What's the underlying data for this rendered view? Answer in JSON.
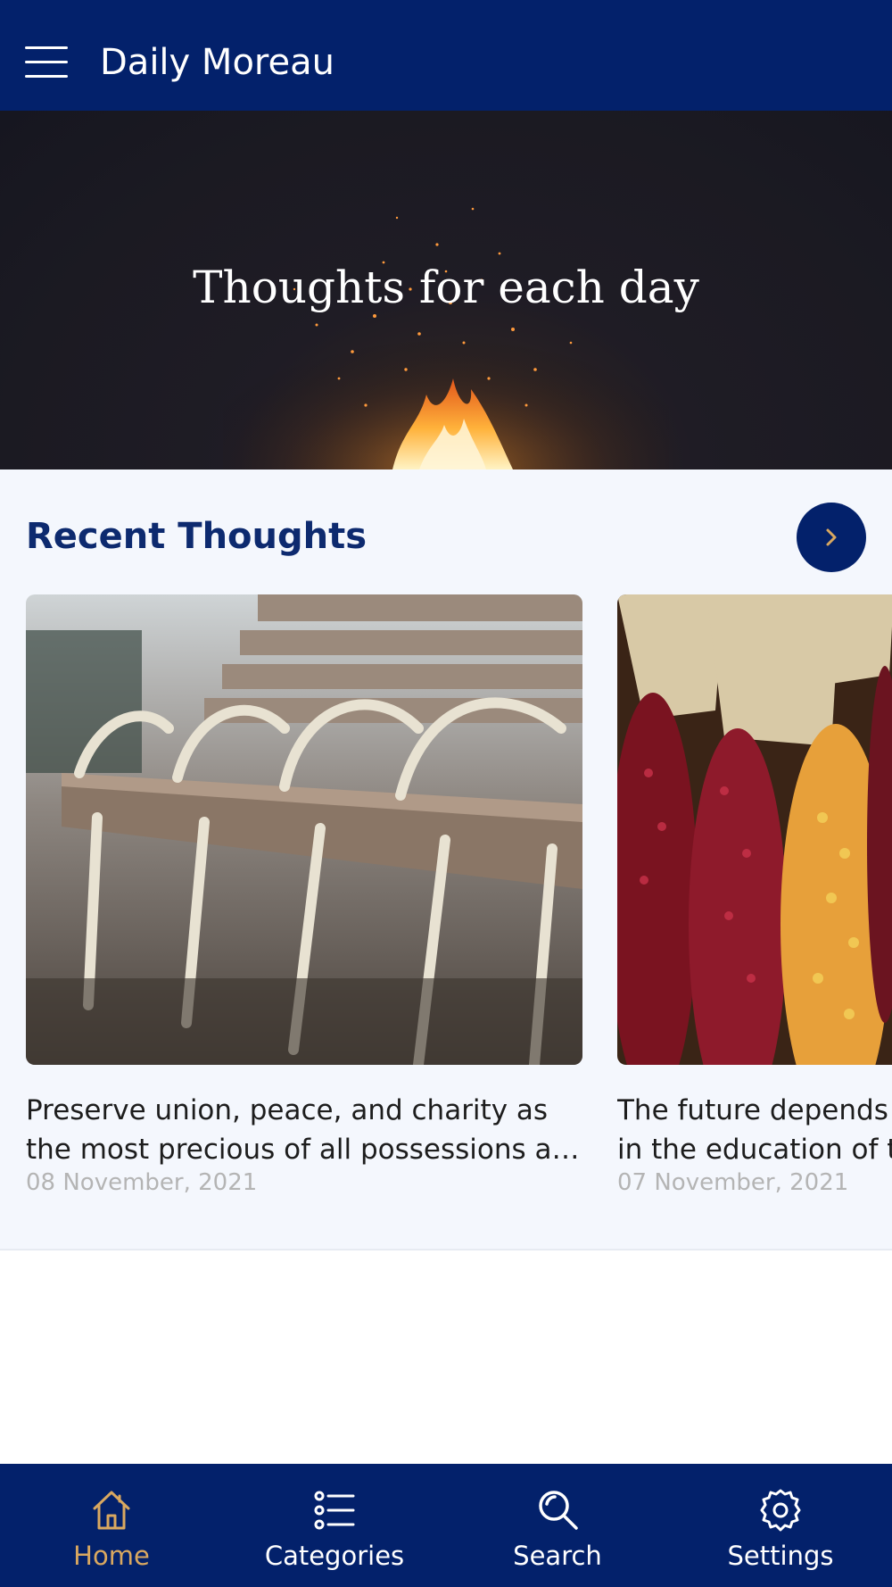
{
  "app": {
    "title": "Daily Moreau",
    "accent": "#03216b",
    "active_color": "#d9a860"
  },
  "header": {
    "menu_icon": "hamburger-menu-icon"
  },
  "hero": {
    "title": "Thoughts for each day"
  },
  "recent": {
    "heading": "Recent Thoughts",
    "next_icon": "chevron-right-icon",
    "cards": [
      {
        "image": "white-benches-photo",
        "text": "Preserve union, peace, and charity as the most precious of all possessions a…",
        "date": "08 November, 2021"
      },
      {
        "image": "colorful-corn-photo",
        "text": "The future depends in the education of t",
        "date": "07 November, 2021"
      }
    ]
  },
  "nav": {
    "items": [
      {
        "label": "Home",
        "icon": "home-icon",
        "active": true
      },
      {
        "label": "Categories",
        "icon": "list-icon",
        "active": false
      },
      {
        "label": "Search",
        "icon": "search-icon",
        "active": false
      },
      {
        "label": "Settings",
        "icon": "gear-icon",
        "active": false
      }
    ]
  }
}
